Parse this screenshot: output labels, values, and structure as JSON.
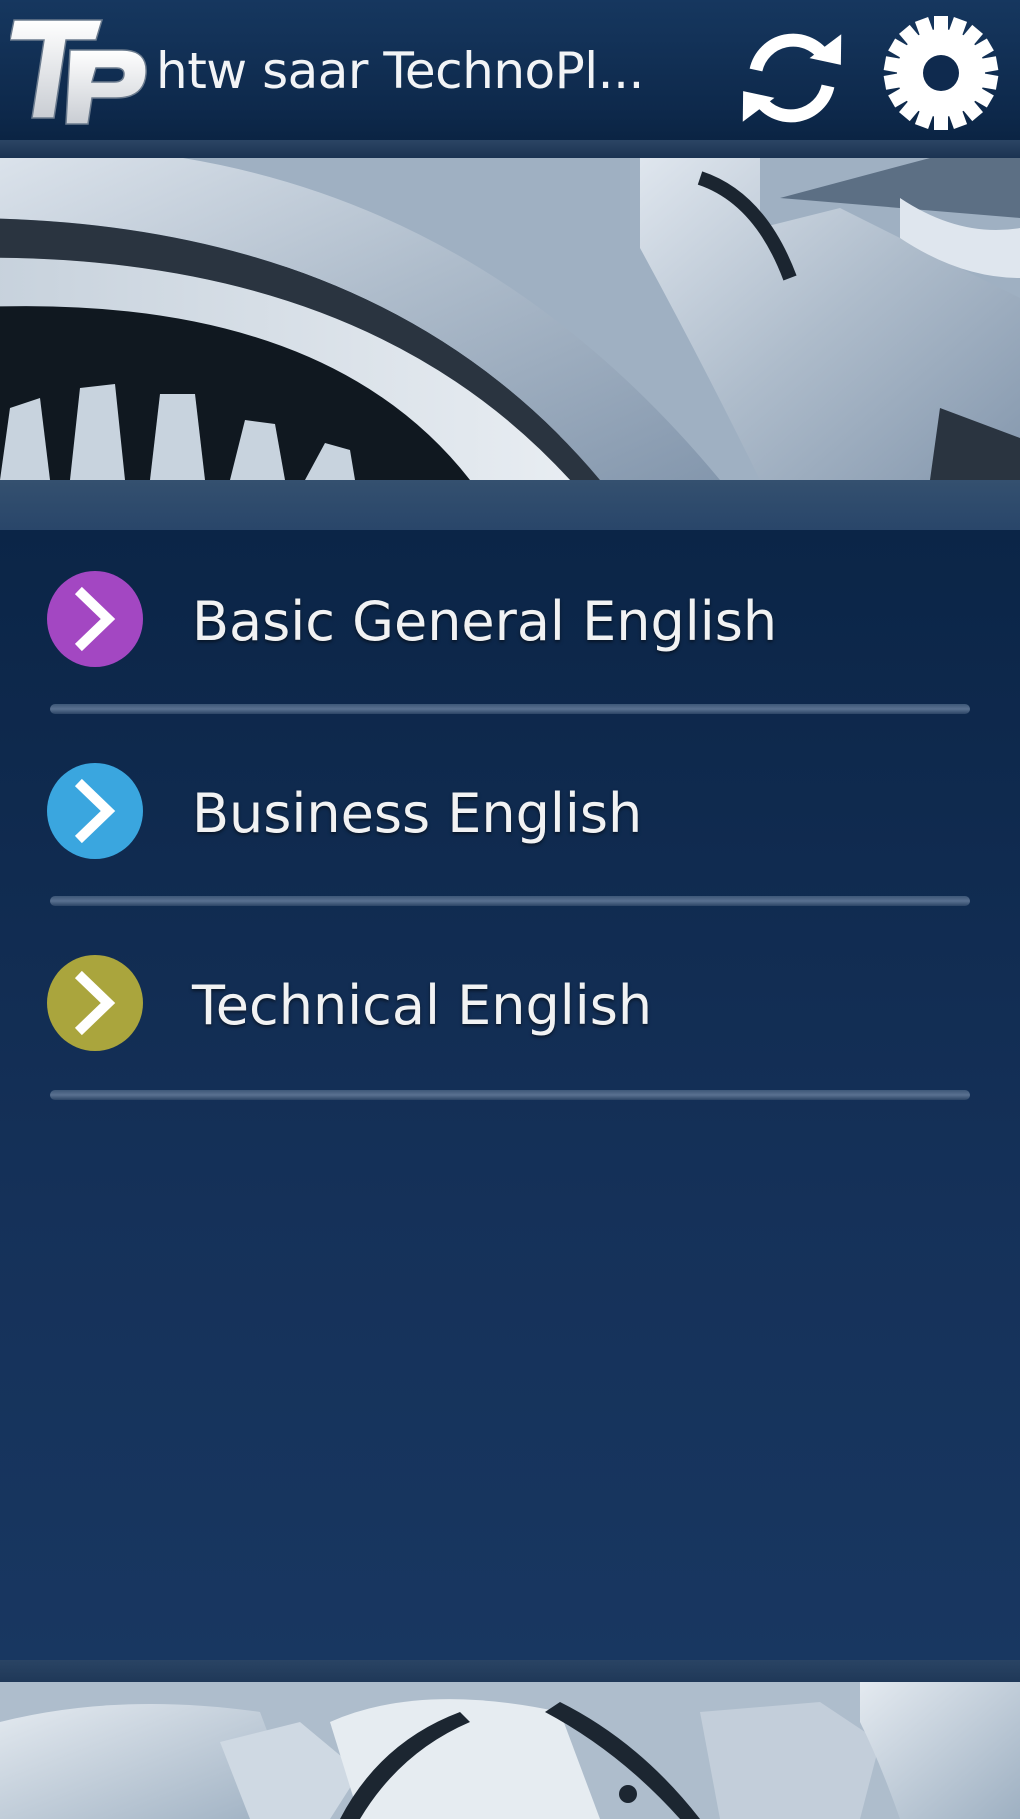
{
  "header": {
    "logo_text": "TP",
    "title": "htw saar TechnoPl..."
  },
  "menu": {
    "items": [
      {
        "label": "Basic General English",
        "color": "#a347c2"
      },
      {
        "label": "Business English",
        "color": "#3aa6df"
      },
      {
        "label": "Technical English",
        "color": "#aaa53d"
      }
    ]
  },
  "icons": {
    "refresh": "refresh-icon",
    "settings": "gear-icon",
    "chevron": "chevron-right-icon"
  },
  "colors": {
    "header_bg": "#0d284a",
    "list_bg": "#153159",
    "text": "#f1f2f3"
  }
}
